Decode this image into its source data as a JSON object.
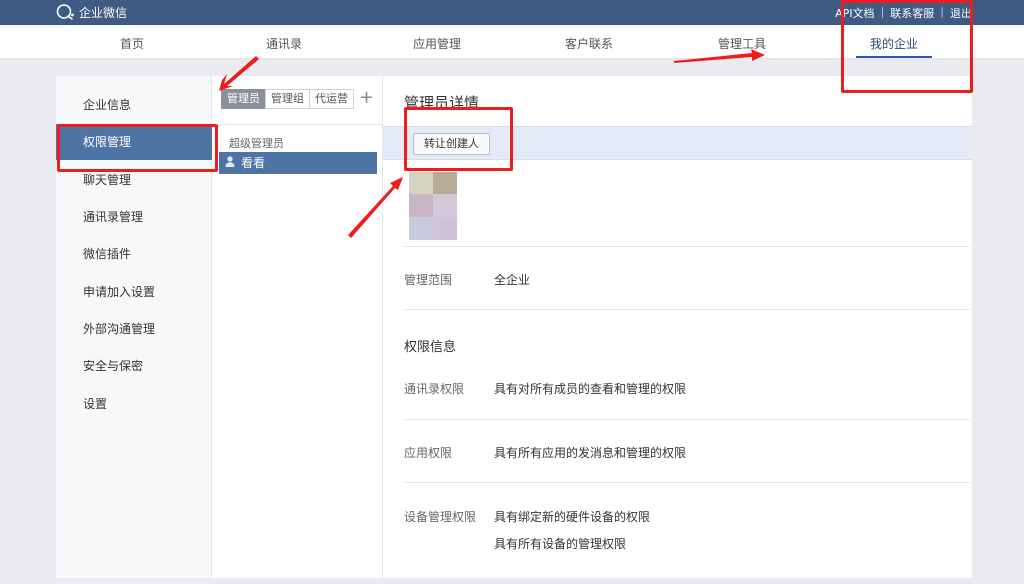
{
  "topbar": {
    "brand": "企业微信",
    "links": [
      "API文档",
      "联系客服",
      "退出"
    ],
    "separator": "|"
  },
  "nav": {
    "items": [
      "首页",
      "通讯录",
      "应用管理",
      "客户联系",
      "管理工具",
      "我的企业"
    ],
    "active": "我的企业"
  },
  "sidebar": {
    "items": [
      "企业信息",
      "权限管理",
      "聊天管理",
      "通讯录管理",
      "微信插件",
      "申请加入设置",
      "外部沟通管理",
      "安全与保密",
      "设置"
    ],
    "active": "权限管理"
  },
  "admin_panel": {
    "tabs": [
      "管理员",
      "管理组",
      "代运营"
    ],
    "add_label": "+",
    "group_label": "超级管理员",
    "selected_admin": "看看"
  },
  "detail": {
    "title": "管理员详情",
    "transfer_button": "转让创建人",
    "scope_label": "管理范围",
    "scope_value": "全企业",
    "permissions_title": "权限信息",
    "contacts_label": "通讯录权限",
    "contacts_value": "具有对所有成员的查看和管理的权限",
    "apps_label": "应用权限",
    "apps_value": "具有所有应用的发消息和管理的权限",
    "device_label": "设备管理权限",
    "device_value_1": "具有绑定新的硬件设备的权限",
    "device_value_2": "具有所有设备的管理权限"
  },
  "colors": {
    "topbar": "#3f5a83",
    "active_menu": "#4e74a6",
    "annotation": "#ee1d1d"
  }
}
